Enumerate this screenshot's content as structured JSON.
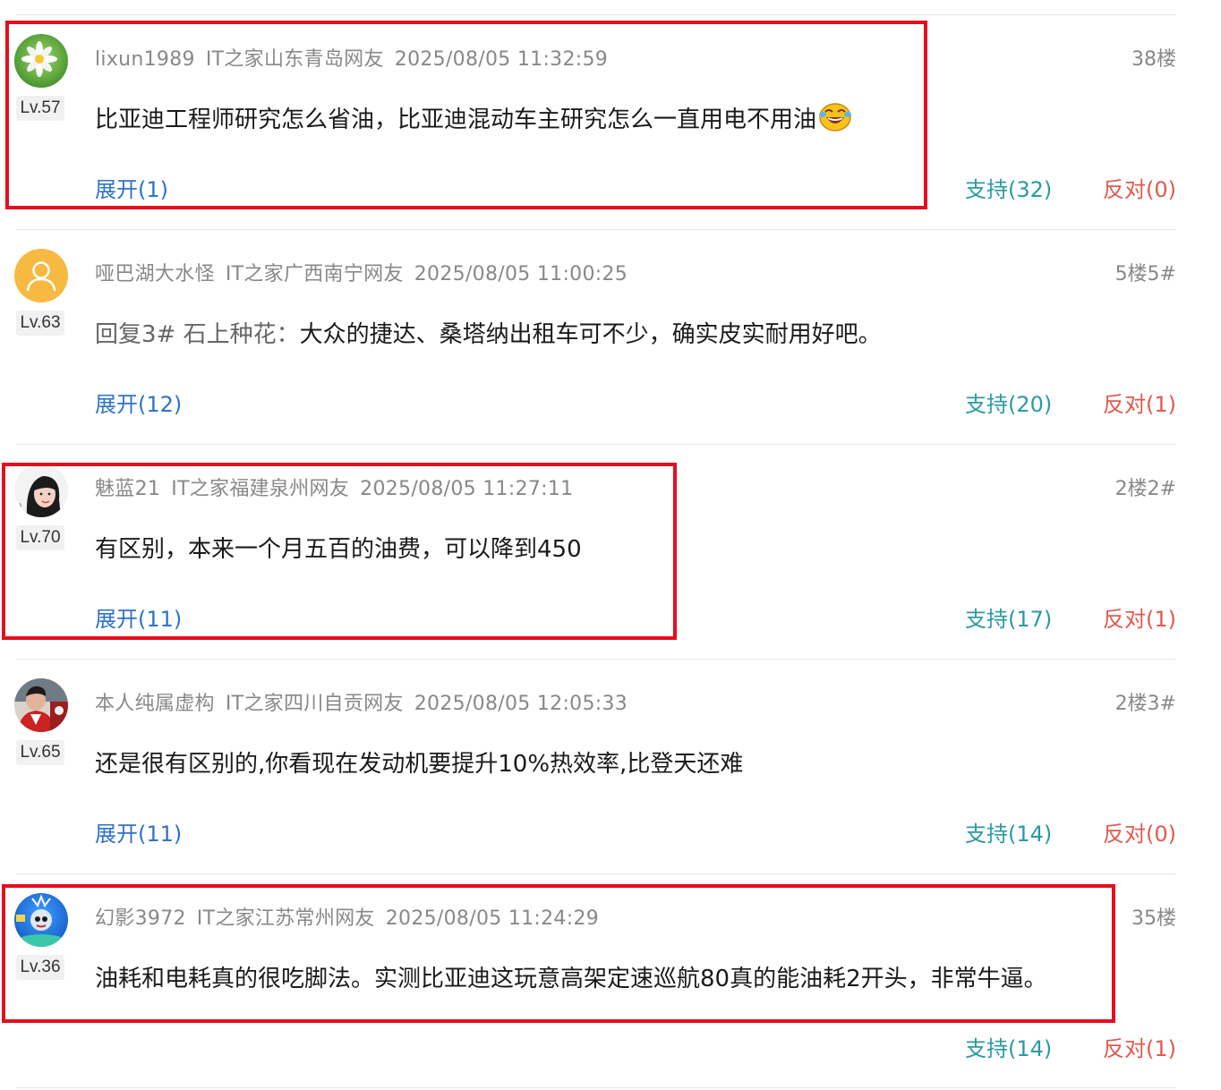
{
  "comments": [
    {
      "username": "lixun1989",
      "location": "IT之家山东青岛网友",
      "time": "2025/08/05 11:32:59",
      "floor": "38楼",
      "level": "Lv.57",
      "text": "比亚迪工程师研究怎么省油，比亚迪混动车主研究怎么一直用电不用油",
      "emoji": "laughing-crying-emoji",
      "expand": "展开(1)",
      "support": "支持(32)",
      "oppose": "反对(0)",
      "avatar": "daisy-avatar"
    },
    {
      "username": "哑巴湖大水怪",
      "location": "IT之家广西南宁网友",
      "time": "2025/08/05 11:00:25",
      "floor": "5楼5#",
      "level": "Lv.63",
      "quote": "回复3# 石上种花：",
      "text": "大众的捷达、桑塔纳出租车可不少，确实皮实耐用好吧。",
      "expand": "展开(12)",
      "support": "支持(20)",
      "oppose": "反对(1)",
      "avatar": "default-user-avatar"
    },
    {
      "username": "魅蓝21",
      "location": "IT之家福建泉州网友",
      "time": "2025/08/05 11:27:11",
      "floor": "2楼2#",
      "level": "Lv.70",
      "text": "有区别，本来一个月五百的油费，可以降到450",
      "expand": "展开(11)",
      "support": "支持(17)",
      "oppose": "反对(1)",
      "avatar": "girl-portrait-avatar"
    },
    {
      "username": "本人纯属虚构",
      "location": "IT之家四川自贡网友",
      "time": "2025/08/05 12:05:33",
      "floor": "2楼3#",
      "level": "Lv.65",
      "text": "还是很有区别的,你看现在发动机要提升10%热效率,比登天还难",
      "expand": "展开(11)",
      "support": "支持(14)",
      "oppose": "反对(0)",
      "avatar": "person-photo-avatar"
    },
    {
      "username": "幻影3972",
      "location": "IT之家江苏常州网友",
      "time": "2025/08/05 11:24:29",
      "floor": "35楼",
      "level": "Lv.36",
      "text": "油耗和电耗真的很吃脚法。实测比亚迪这玩意高架定速巡航80真的能油耗2开头，非常牛逼。",
      "support": "支持(14)",
      "oppose": "反对(1)",
      "avatar": "cartoon-avatar"
    }
  ],
  "highlight_color": "#e30f1d",
  "link_color": "#2d73c8",
  "support_color": "#2a9aa3",
  "oppose_color": "#e05a4e"
}
